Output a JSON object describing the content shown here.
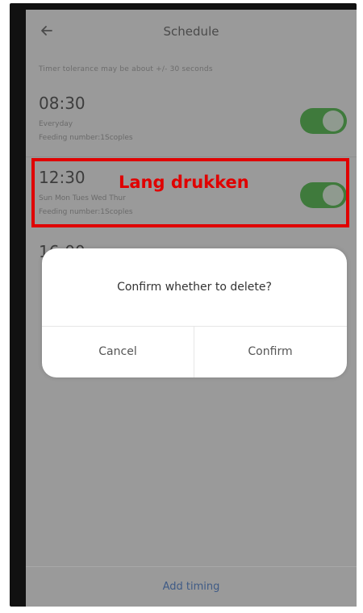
{
  "header": {
    "title": "Schedule"
  },
  "hint": {
    "text": "Timer tolerance may be about +/- 30 seconds"
  },
  "schedules": [
    {
      "time": "08:30",
      "days": "Everyday",
      "feeding": "Feeding number:1Scoples",
      "enabled": true
    },
    {
      "time": "12:30",
      "days": "Sun Mon Tues Wed Thur",
      "feeding": "Feeding number:1Scoples",
      "enabled": true
    },
    {
      "time": "16:00",
      "days": "",
      "feeding": "",
      "enabled": true
    }
  ],
  "annotation": {
    "text": "Lang drukken"
  },
  "dialog": {
    "message": "Confirm whether to delete?",
    "cancel_label": "Cancel",
    "confirm_label": "Confirm"
  },
  "footer": {
    "add_label": "Add timing"
  },
  "colors": {
    "highlight": "#e00000",
    "toggle_on": "#3f7a3c",
    "link": "#3f5b86"
  }
}
